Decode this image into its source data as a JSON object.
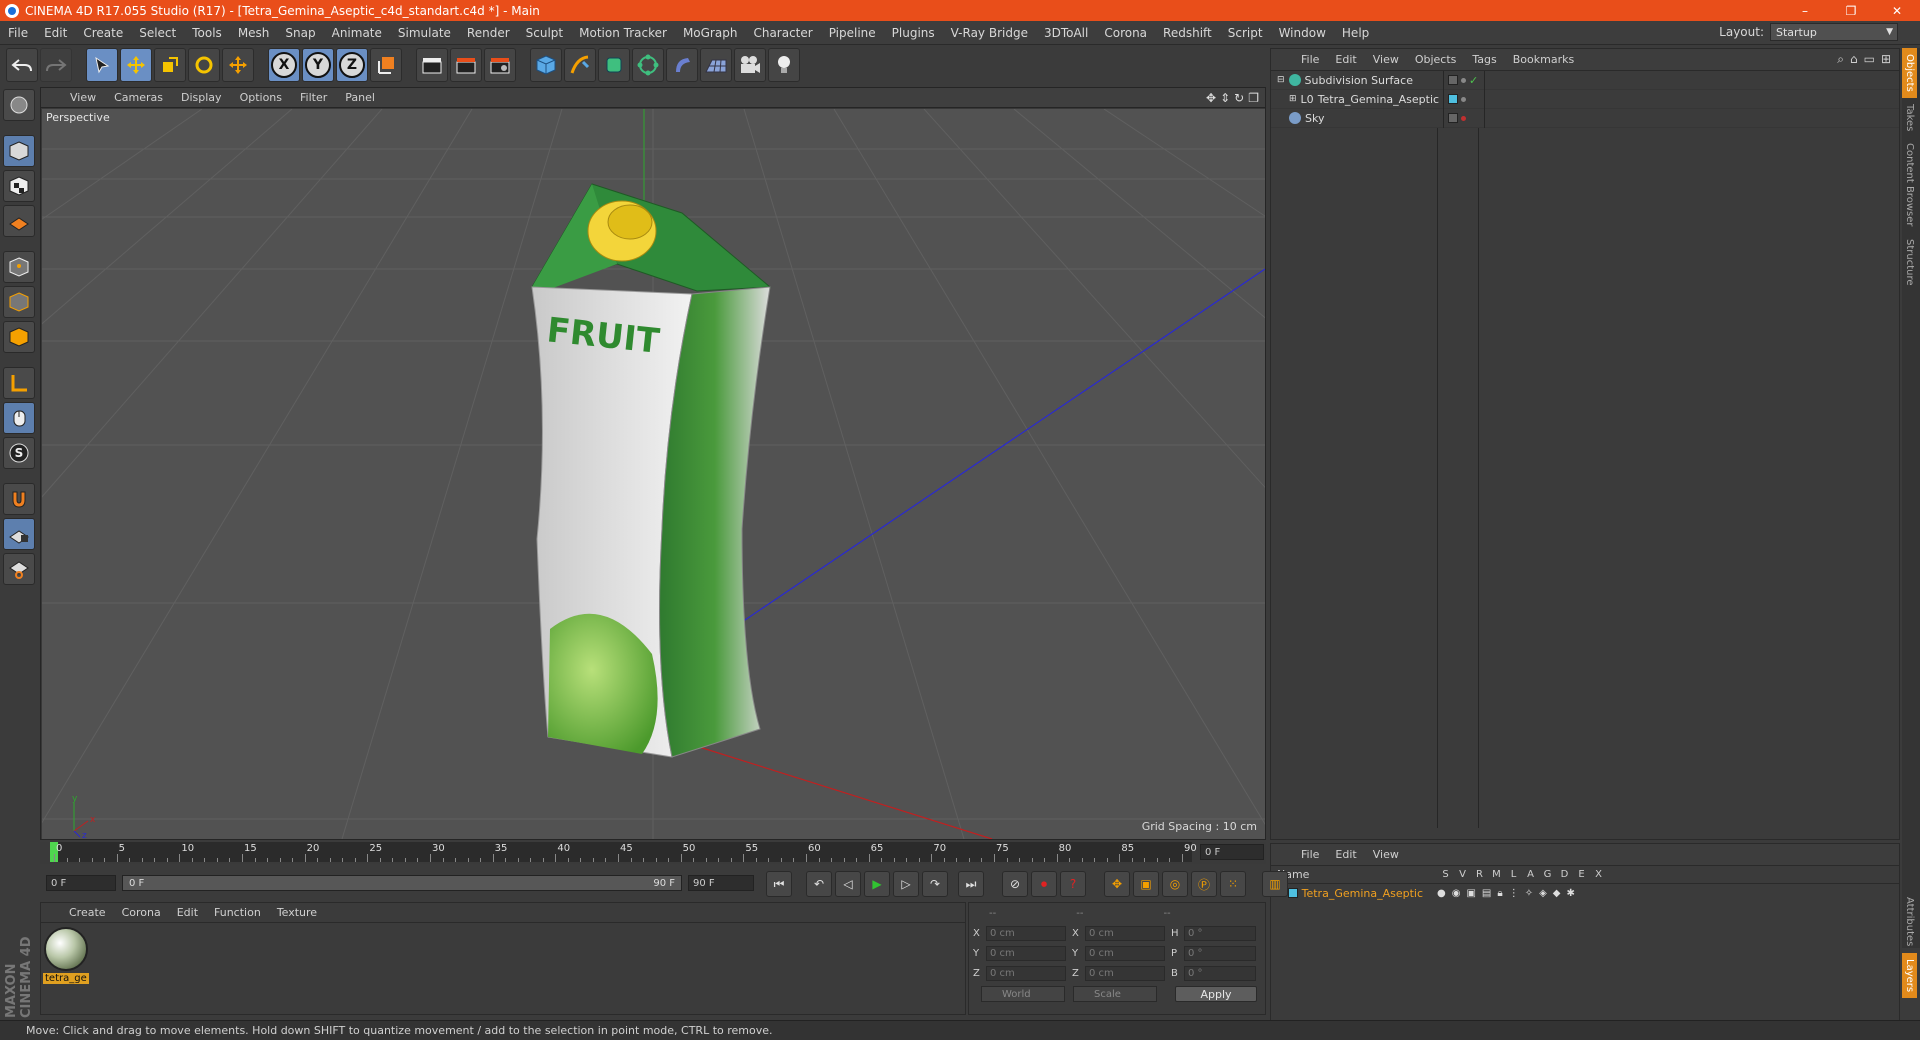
{
  "window": {
    "title": "CINEMA 4D R17.055 Studio (R17) - [Tetra_Gemina_Aseptic_c4d_standart.c4d *] - Main",
    "minimize": "–",
    "restore": "❐",
    "close": "✕"
  },
  "menubar": {
    "items": [
      "File",
      "Edit",
      "Create",
      "Select",
      "Tools",
      "Mesh",
      "Snap",
      "Animate",
      "Simulate",
      "Render",
      "Sculpt",
      "Motion Tracker",
      "MoGraph",
      "Character",
      "Pipeline",
      "Plugins",
      "V-Ray Bridge",
      "3DToAll",
      "Corona",
      "Redshift",
      "Script",
      "Window",
      "Help"
    ],
    "layout_label": "Layout:",
    "layout_value": "Startup"
  },
  "toolbar": {
    "axis_x": "X",
    "axis_y": "Y",
    "axis_z": "Z"
  },
  "viewport": {
    "menu": [
      "View",
      "Cameras",
      "Display",
      "Options",
      "Filter",
      "Panel"
    ],
    "label": "Perspective",
    "grid_spacing": "Grid Spacing : 10 cm",
    "axis_x": "x",
    "axis_y": "y",
    "axis_z": "z",
    "product_text": "FRUIT"
  },
  "object_manager": {
    "menu": [
      "File",
      "Edit",
      "View",
      "Objects",
      "Tags",
      "Bookmarks"
    ],
    "objects": [
      {
        "name": "Subdivision Surface",
        "color": "#3fb6a0"
      },
      {
        "name": "Tetra_Gemina_Aseptic",
        "color": "#4fc0e0"
      },
      {
        "name": "Sky",
        "color": "#7a9cc8"
      }
    ]
  },
  "side_tabs": [
    "Objects",
    "Takes",
    "Content Browser",
    "Structure"
  ],
  "side_tabs_lower": [
    "Attributes",
    "Layers"
  ],
  "layers": {
    "menu": [
      "File",
      "Edit",
      "View"
    ],
    "header_name": "Name",
    "columns": [
      "S",
      "V",
      "R",
      "M",
      "L",
      "A",
      "G",
      "D",
      "E",
      "X"
    ],
    "row_name": "Tetra_Gemina_Aseptic"
  },
  "timeline": {
    "labels": [
      "0",
      "5",
      "10",
      "15",
      "20",
      "25",
      "30",
      "35",
      "40",
      "45",
      "50",
      "55",
      "60",
      "65",
      "70",
      "75",
      "80",
      "85",
      "90"
    ],
    "current_frame": "0 F",
    "start_field": "0 F",
    "range_start": "0 F",
    "range_end": "90 F",
    "end_field": "90 F"
  },
  "material_manager": {
    "menu": [
      "Create",
      "Corona",
      "Edit",
      "Function",
      "Texture"
    ],
    "material_name": "tetra_ge"
  },
  "coordinates": {
    "head": [
      "--",
      "--",
      "--"
    ],
    "rows": [
      {
        "l1": "X",
        "v1": "0 cm",
        "l2": "X",
        "v2": "0 cm",
        "l3": "H",
        "v3": "0 °"
      },
      {
        "l1": "Y",
        "v1": "0 cm",
        "l2": "Y",
        "v2": "0 cm",
        "l3": "P",
        "v3": "0 °"
      },
      {
        "l1": "Z",
        "v1": "0 cm",
        "l2": "Z",
        "v2": "0 cm",
        "l3": "B",
        "v3": "0 °"
      }
    ],
    "world": "World",
    "scale": "Scale",
    "apply": "Apply"
  },
  "status": {
    "text": "Move: Click and drag to move elements. Hold down SHIFT to quantize movement / add to the selection in point mode, CTRL to remove."
  },
  "logo": {
    "text": "MAXON CINEMA 4D"
  }
}
